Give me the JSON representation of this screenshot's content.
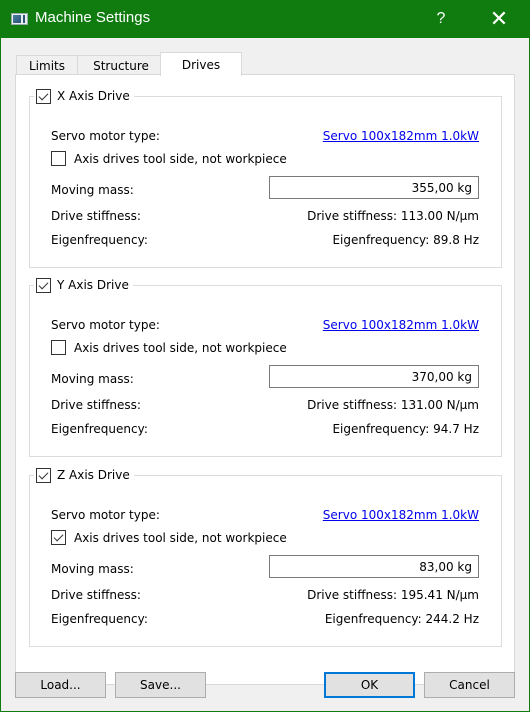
{
  "window": {
    "title": "Machine Settings",
    "help_label": "?",
    "close_label": "✕"
  },
  "tabs": [
    {
      "label": "Limits",
      "active": false
    },
    {
      "label": "Structure",
      "active": false
    },
    {
      "label": "Drives",
      "active": true
    }
  ],
  "labels": {
    "servo_motor_type": "Servo motor type:",
    "axis_drives_tool_side": "Axis drives tool side, not workpiece",
    "moving_mass": "Moving mass:",
    "drive_stiffness": "Drive stiffness:",
    "eigenfrequency": "Eigenfrequency:"
  },
  "drives": [
    {
      "title": "X Axis Drive",
      "enabled": true,
      "servo_motor": "Servo 100x182mm 1.0kW",
      "tool_side": false,
      "moving_mass": "355,00 kg",
      "stiffness_text": "Drive stiffness: 113.00 N/µm",
      "eigenfrequency_text": "Eigenfrequency: 89.8 Hz"
    },
    {
      "title": "Y Axis Drive",
      "enabled": true,
      "servo_motor": "Servo 100x182mm 1.0kW",
      "tool_side": false,
      "moving_mass": "370,00 kg",
      "stiffness_text": "Drive stiffness: 131.00 N/µm",
      "eigenfrequency_text": "Eigenfrequency: 94.7 Hz"
    },
    {
      "title": "Z Axis Drive",
      "enabled": true,
      "servo_motor": "Servo 100x182mm 1.0kW",
      "tool_side": true,
      "moving_mass": "83,00 kg",
      "stiffness_text": "Drive stiffness: 195.41 N/µm",
      "eigenfrequency_text": "Eigenfrequency: 244.2 Hz"
    }
  ],
  "buttons": {
    "load": "Load...",
    "save": "Save...",
    "ok": "OK",
    "cancel": "Cancel"
  },
  "colors": {
    "titlebar": "#107c10",
    "link": "#0000ee",
    "default_button_border": "#0078d7"
  }
}
